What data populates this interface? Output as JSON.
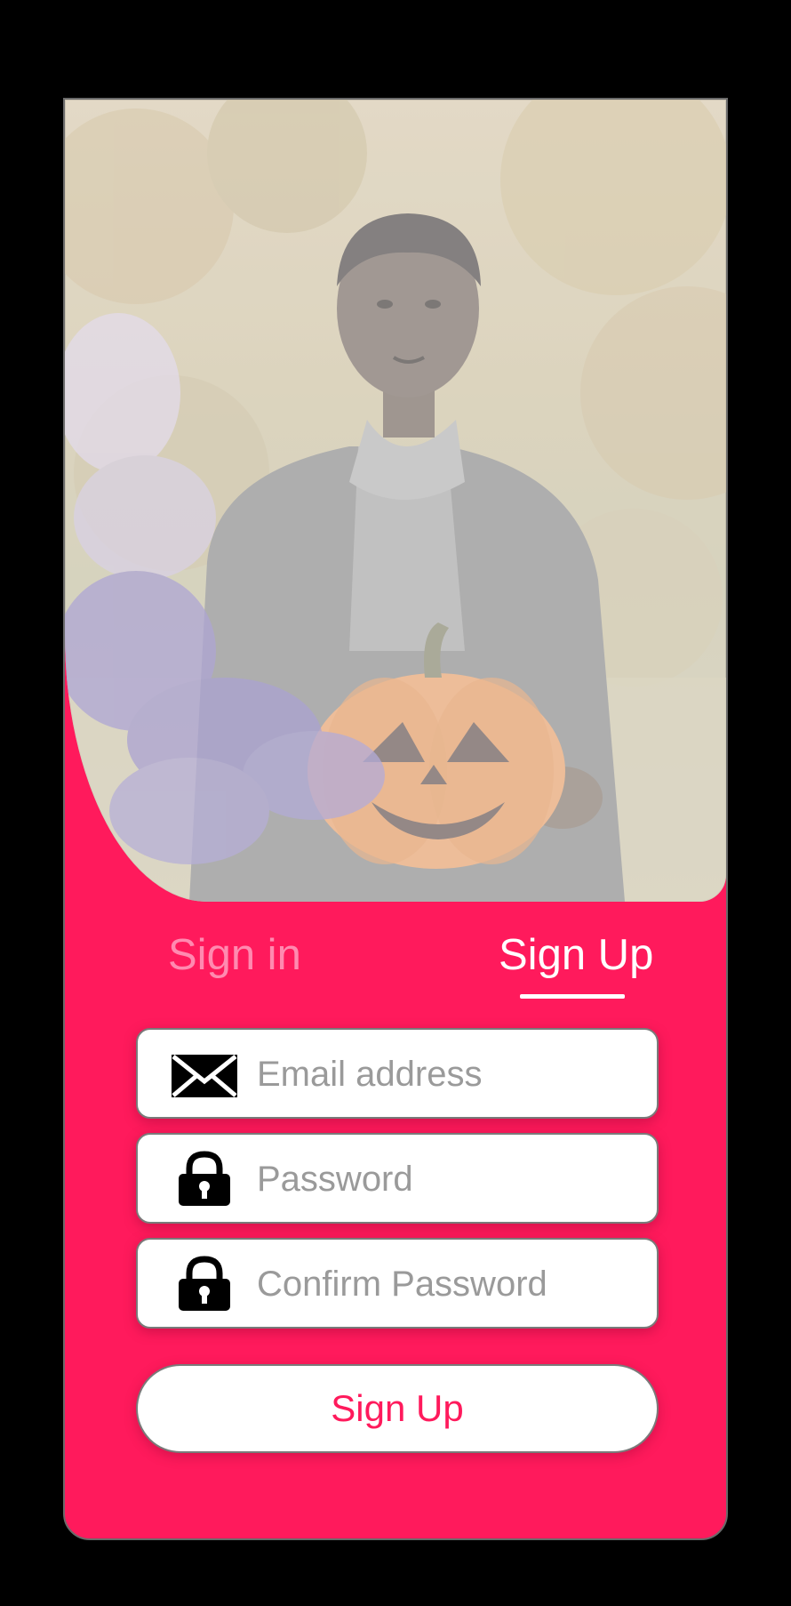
{
  "tabs": {
    "signin_label": "Sign in",
    "signup_label": "Sign Up",
    "active": "signup"
  },
  "form": {
    "email_placeholder": "Email address",
    "password_placeholder": "Password",
    "confirm_placeholder": "Confirm Password",
    "submit_label": "Sign Up"
  },
  "icons": {
    "email": "envelope-icon",
    "password": "lock-icon",
    "confirm": "lock-icon"
  },
  "colors": {
    "accent": "#ff1a5c",
    "inactive_tab": "#ff8ab0",
    "background": "#000000"
  }
}
